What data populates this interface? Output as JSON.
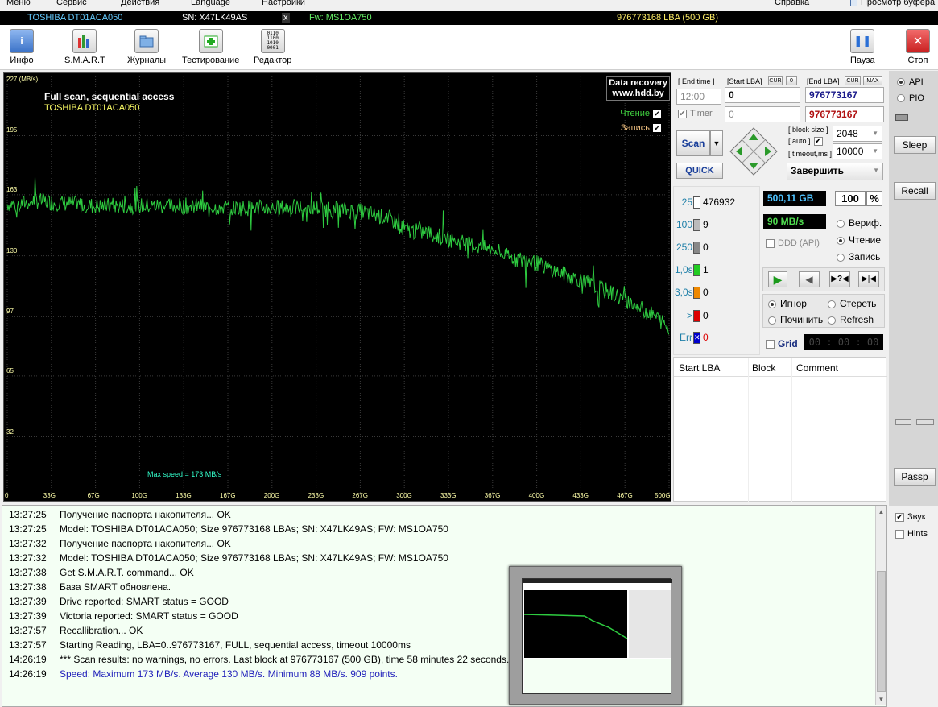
{
  "menu": [
    "Меню",
    "Сервис",
    "Действия",
    "Language",
    "Настройки",
    "Справка",
    "Просмотр буфера"
  ],
  "infobar": {
    "model": "TOSHIBA DT01ACA050",
    "sn": "SN: X47LK49AS",
    "close": "x",
    "fw": "Fw: MS1OA750",
    "lba": "976773168 LBA (500 GB)"
  },
  "toolbar": {
    "info": "Инфо",
    "smart": "S.M.A.R.T",
    "logs": "Журналы",
    "test": "Тестирование",
    "editor": "Редактор",
    "pause": "Пауза",
    "stop": "Стоп"
  },
  "graph": {
    "title": "Full scan, sequential access",
    "subtitle": "TOSHIBA DT01ACA050",
    "data_recovery_1": "Data recovery",
    "data_recovery_2": "www.hdd.by",
    "legend_read": "Чтение",
    "legend_write": "Запись",
    "max_speed": "Max speed = 173 MB/s",
    "y_unit": "227 (MB/s)"
  },
  "chart_data": {
    "type": "line",
    "xlabel": "",
    "ylabel": "",
    "y_ticks": [
      195,
      163,
      130,
      97,
      65,
      32
    ],
    "x_ticks": [
      "0",
      "33G",
      "67G",
      "100G",
      "133G",
      "167G",
      "200G",
      "233G",
      "267G",
      "300G",
      "333G",
      "367G",
      "400G",
      "433G",
      "467G",
      "500G"
    ],
    "ylim": [
      0,
      227
    ],
    "xlim": [
      0,
      500
    ],
    "series": [
      {
        "name": "Чтение",
        "color": "#2ecc40",
        "points": [
          [
            0,
            158
          ],
          [
            10,
            158
          ],
          [
            20,
            160
          ],
          [
            33,
            159
          ],
          [
            50,
            158
          ],
          [
            67,
            157
          ],
          [
            100,
            157
          ],
          [
            133,
            157
          ],
          [
            167,
            156
          ],
          [
            200,
            156
          ],
          [
            233,
            156
          ],
          [
            267,
            154
          ],
          [
            290,
            150
          ],
          [
            300,
            144
          ],
          [
            320,
            142
          ],
          [
            333,
            139
          ],
          [
            350,
            136
          ],
          [
            367,
            133
          ],
          [
            380,
            129
          ],
          [
            400,
            126
          ],
          [
            420,
            120
          ],
          [
            433,
            117
          ],
          [
            450,
            112
          ],
          [
            467,
            106
          ],
          [
            480,
            101
          ],
          [
            490,
            97
          ],
          [
            500,
            91
          ]
        ]
      }
    ]
  },
  "controls": {
    "end_time_lbl": "[ End time ]",
    "start_lba_lbl": "[Start LBA]",
    "cur_lbl": "CUR",
    "zero_lbl": "0",
    "end_lba_lbl": "[End LBA]",
    "cur2_lbl": "CUR",
    "max_lbl": "MAX",
    "time_val": "12:00",
    "start_lba": "0",
    "end_lba": "976773167",
    "end_lba2": "976773167",
    "timer_lbl": "Timer",
    "timer_val": "0",
    "scan_btn": "Scan",
    "quick_btn": "QUICK",
    "block_size_lbl": "[ block size ]",
    "auto_lbl": "[ auto ]",
    "timeout_lbl": "[ timeout,ms ]",
    "block_size": "2048",
    "timeout": "10000",
    "finish": "Завершить"
  },
  "stats": [
    {
      "label": "25",
      "count": "476932",
      "color": "#ffffff"
    },
    {
      "label": "100",
      "count": "9",
      "color": "#bbbbbb"
    },
    {
      "label": "250",
      "count": "0",
      "color": "#888888"
    },
    {
      "label": "1,0s",
      "count": "1",
      "color": "#22cc22"
    },
    {
      "label": "3,0s",
      "count": "0",
      "color": "#ee8800"
    },
    {
      "label": ">",
      "count": "0",
      "color": "#dd0000"
    },
    {
      "label": "Err",
      "count": "0",
      "color": "#0000cc"
    }
  ],
  "progress": {
    "size": "500,11 GB",
    "percent": "100",
    "pct_sign": "%",
    "speed": "90 MB/s",
    "ddd": "DDD (API)"
  },
  "modes": {
    "verify": "Вериф.",
    "read": "Чтение",
    "write": "Запись"
  },
  "actions": {
    "ignore": "Игнор",
    "erase": "Стереть",
    "fix": "Починить",
    "refresh": "Refresh"
  },
  "grid": {
    "label": "Grid",
    "clock": "00 : 00 : 00"
  },
  "table_cols": [
    "Start LBA",
    "Block",
    "Comment"
  ],
  "right": {
    "api": "API",
    "pio": "PIO",
    "sleep": "Sleep",
    "recall": "Recall",
    "passp": "Passp",
    "sound": "Звук",
    "hints": "Hints"
  },
  "log": [
    {
      "t": "13:27:25",
      "m": "Получение паспорта накопителя... OK"
    },
    {
      "t": "13:27:25",
      "m": "Model: TOSHIBA DT01ACA050; Size 976773168 LBAs; SN: X47LK49AS; FW: MS1OA750"
    },
    {
      "t": "13:27:32",
      "m": "Получение паспорта накопителя... OK"
    },
    {
      "t": "13:27:32",
      "m": "Model: TOSHIBA DT01ACA050; Size 976773168 LBAs; SN: X47LK49AS; FW: MS1OA750"
    },
    {
      "t": "13:27:38",
      "m": "Get S.M.A.R.T. command... OK"
    },
    {
      "t": "13:27:38",
      "m": "База SMART обновлена."
    },
    {
      "t": "13:27:39",
      "m": "Drive reported: SMART status = GOOD"
    },
    {
      "t": "13:27:39",
      "m": "Victoria reported: SMART status = GOOD"
    },
    {
      "t": "13:27:57",
      "m": "Recallibration... OK"
    },
    {
      "t": "13:27:57",
      "m": "Starting Reading, LBA=0..976773167, FULL, sequential access, timeout 10000ms"
    },
    {
      "t": "14:26:19",
      "m": "*** Scan results: no warnings, no errors. Last block at 976773167 (500 GB), time 58 minutes 22 seconds."
    },
    {
      "t": "14:26:19",
      "m": "Speed: Maximum 173 MB/s. Average 130 MB/s. Minimum 88 MB/s. 909 points.",
      "color": "#2222bb"
    }
  ]
}
